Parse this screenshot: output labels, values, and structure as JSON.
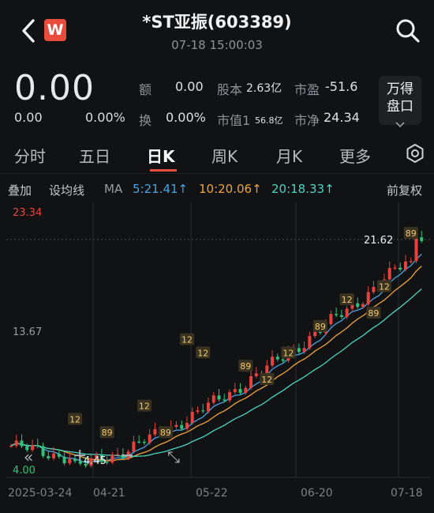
{
  "header": {
    "logo_text": "W",
    "title": "*ST亚振(603389)",
    "datetime": "07-18 15:00:03"
  },
  "quote": {
    "price": "0.00",
    "change": "0.00",
    "change_pct": "0.00%",
    "amount_label": "额",
    "amount_value": "0.00",
    "turnover_label": "换",
    "turnover_value": "0.00%",
    "shares_label": "股本",
    "shares_value": "2.63亿",
    "mcap_label": "市值1",
    "mcap_value": "56.8亿",
    "pe_label": "市盈",
    "pe_value": "-51.6",
    "pb_label": "市净",
    "pb_value": "24.34",
    "wande_line1": "万得",
    "wande_line2": "盘口"
  },
  "tabs": [
    "分时",
    "五日",
    "日K",
    "周K",
    "月K",
    "更多"
  ],
  "active_tab": "日K",
  "indicator_bar": {
    "overlay": "叠加",
    "set_ma": "设均线",
    "ma": "MA",
    "ma5": "5:21.41↑",
    "ma10": "10:20.06↑",
    "ma20": "20:18.33↑",
    "adjust": "前复权"
  },
  "colors": {
    "up": "#e8423e",
    "down": "#2ec27a",
    "ma5": "#4aa3df",
    "ma10": "#f0a33a",
    "ma20": "#49d6c4",
    "accent": "#e84c3d"
  },
  "chart_data": {
    "type": "candlestick",
    "y_max_label": "23.34",
    "y_mid_label": "13.67",
    "y_min_label": "4.00",
    "last_price_label": "21.62",
    "low_marker_label": "4.45",
    "ylim": [
      4.0,
      23.34
    ],
    "x_dates": [
      "2025-03-24",
      "04-21",
      "05-22",
      "06-20",
      "07-18"
    ],
    "badges": [
      "12",
      "89",
      "12",
      "89",
      "12",
      "12",
      "89",
      "12",
      "12",
      "89",
      "12",
      "89",
      "12",
      "89"
    ],
    "controls": [
      "«",
      "+",
      "−",
      "⤡"
    ]
  }
}
